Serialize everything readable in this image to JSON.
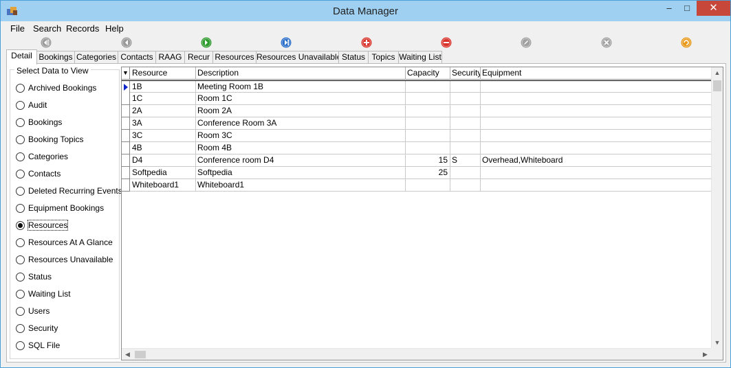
{
  "window": {
    "title": "Data Manager",
    "minimize": "–",
    "maximize": "□",
    "close": "✕"
  },
  "menu": [
    "File",
    "Search",
    "Records",
    "Help"
  ],
  "toolbar": [
    {
      "name": "first-record-icon",
      "color": "#9a9a9a",
      "glyph": "first"
    },
    {
      "name": "previous-record-icon",
      "color": "#9a9a9a",
      "glyph": "prev"
    },
    {
      "name": "next-record-icon",
      "color": "#2e9b2e",
      "glyph": "next"
    },
    {
      "name": "last-record-icon",
      "color": "#2a6fc9",
      "glyph": "last"
    },
    {
      "name": "add-record-icon",
      "color": "#d9342b",
      "glyph": "plus"
    },
    {
      "name": "delete-record-icon",
      "color": "#d9342b",
      "glyph": "minus"
    },
    {
      "name": "edit-record-icon",
      "color": "#a0a0a0",
      "glyph": "edit"
    },
    {
      "name": "cancel-edit-icon",
      "color": "#a0a0a0",
      "glyph": "cross"
    },
    {
      "name": "refresh-icon",
      "color": "#e89a1c",
      "glyph": "refresh"
    }
  ],
  "tabs": [
    "Detail",
    "Bookings",
    "Categories",
    "Contacts",
    "RAAG",
    "Recur",
    "Resources",
    "Resources Unavailable",
    "Status",
    "Topics",
    "Waiting List"
  ],
  "active_tab": "Detail",
  "select_group": {
    "legend": "Select Data to View",
    "options": [
      "Archived Bookings",
      "Audit",
      "Bookings",
      "Booking Topics",
      "Categories",
      "Contacts",
      "Deleted Recurring Events",
      "Equipment Bookings",
      "Resources",
      "Resources At A Glance",
      "Resources Unavailable",
      "Status",
      "Waiting List",
      "Users",
      "Security",
      "SQL File"
    ],
    "selected": "Resources"
  },
  "grid": {
    "sort_indicator": "▼",
    "columns": [
      "Resource",
      "Description",
      "Capacity",
      "Security",
      "Equipment"
    ],
    "rows": [
      [
        "1B",
        "Meeting Room 1B",
        "",
        "",
        ""
      ],
      [
        "1C",
        "Room 1C",
        "",
        "",
        ""
      ],
      [
        "2A",
        "Room 2A",
        "",
        "",
        ""
      ],
      [
        "3A",
        "Conference Room 3A",
        "",
        "",
        ""
      ],
      [
        "3C",
        "Room 3C",
        "",
        "",
        ""
      ],
      [
        "4B",
        "Room 4B",
        "",
        "",
        ""
      ],
      [
        "D4",
        "Conference room D4",
        "15",
        "S",
        "Overhead,Whiteboard"
      ],
      [
        "Softpedia",
        "Softpedia",
        "25",
        "",
        ""
      ],
      [
        "Whiteboard1",
        "Whiteboard1",
        "",
        "",
        ""
      ]
    ],
    "current_row": 0
  },
  "scroll": {
    "up": "▲",
    "down": "▼",
    "left": "◀",
    "right": "▶"
  }
}
